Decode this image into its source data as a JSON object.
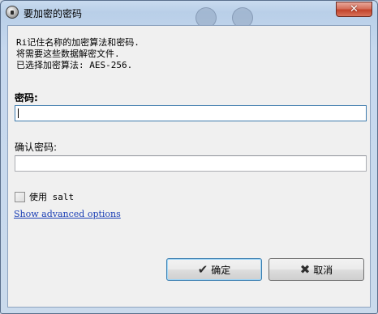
{
  "window": {
    "title": "要加密的密码",
    "close_glyph": "✕"
  },
  "info": {
    "lines": [
      "Ri记住名称的加密算法和密码.",
      "将需要这些数据解密文件.",
      "已选择加密算法: AES-256."
    ]
  },
  "password": {
    "label": "密码:",
    "value": ""
  },
  "confirm": {
    "label": "确认密码:",
    "value": ""
  },
  "salt": {
    "label": "使用 salt",
    "checked": false
  },
  "advanced_link": "Show advanced options",
  "buttons": {
    "ok_label": "确定",
    "ok_icon": "check-icon",
    "cancel_label": "取消",
    "cancel_icon": "x-icon"
  },
  "colors": {
    "titlebar": "#bdd2ea",
    "close_button": "#c2432b",
    "link": "#1a3eb5",
    "focus_border": "#3d7bad"
  }
}
